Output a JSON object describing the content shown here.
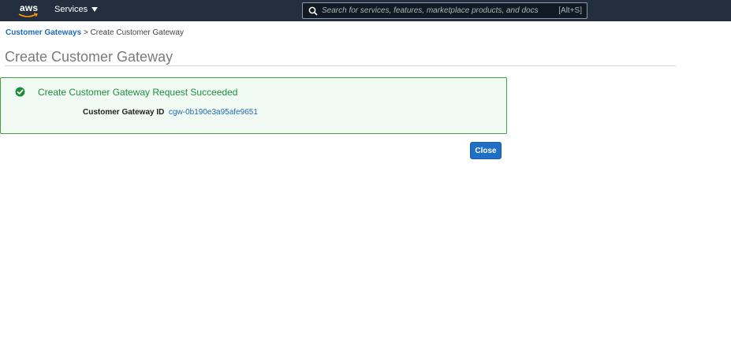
{
  "nav": {
    "logo_text": "aws",
    "services_label": "Services",
    "search_placeholder": "Search for services, features, marketplace products, and docs",
    "search_shortcut": "[Alt+S]"
  },
  "breadcrumb": {
    "parent": "Customer Gateways",
    "separator": ">",
    "current": "Create Customer Gateway"
  },
  "page": {
    "title": "Create Customer Gateway"
  },
  "alert": {
    "title": "Create Customer Gateway Request Succeeded",
    "field_label": "Customer Gateway ID",
    "field_value": "cgw-0b190e3a95afe9651"
  },
  "actions": {
    "close_label": "Close"
  },
  "colors": {
    "nav_bg": "#232f3e",
    "success": "#1e8e3e",
    "link": "#1d6bb5",
    "primary_button": "#1f6fc5"
  }
}
